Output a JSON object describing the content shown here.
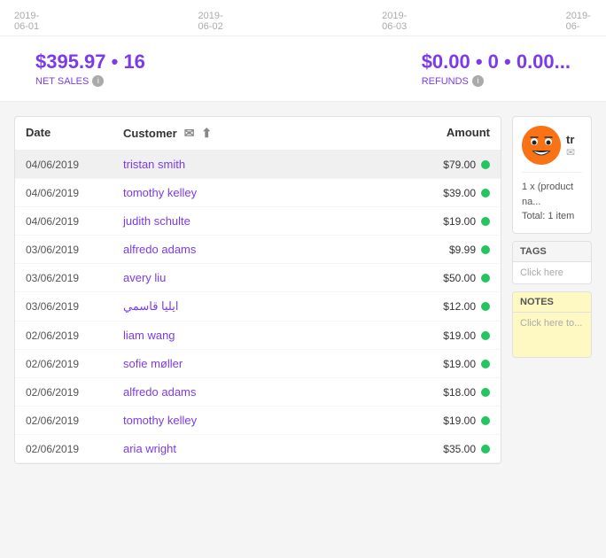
{
  "chart": {
    "dates": [
      "2019-06-01",
      "2019-06-02",
      "2019-06-03",
      "2019-06-"
    ]
  },
  "stats": {
    "net_sales_value": "$395.97 • 16",
    "net_sales_label": "NET SALES",
    "refunds_value": "$0.00 • 0 • 0.00...",
    "refunds_label": "REFUNDS"
  },
  "table": {
    "headers": {
      "date": "Date",
      "customer": "Customer",
      "amount": "Amount"
    },
    "rows": [
      {
        "date": "04/06/2019",
        "customer": "tristan smith",
        "amount": "$79.00",
        "status": "green",
        "selected": true
      },
      {
        "date": "04/06/2019",
        "customer": "tomothy kelley",
        "amount": "$39.00",
        "status": "green",
        "selected": false
      },
      {
        "date": "04/06/2019",
        "customer": "judith schulte",
        "amount": "$19.00",
        "status": "green",
        "selected": false
      },
      {
        "date": "03/06/2019",
        "customer": "alfredo adams",
        "amount": "$9.99",
        "status": "green",
        "selected": false
      },
      {
        "date": "03/06/2019",
        "customer": "avery liu",
        "amount": "$50.00",
        "status": "green",
        "selected": false
      },
      {
        "date": "03/06/2019",
        "customer": "ايليا قاسمي",
        "amount": "$12.00",
        "status": "green",
        "selected": false
      },
      {
        "date": "02/06/2019",
        "customer": "liam wang",
        "amount": "$19.00",
        "status": "green",
        "selected": false
      },
      {
        "date": "02/06/2019",
        "customer": "sofie møller",
        "amount": "$19.00",
        "status": "green",
        "selected": false
      },
      {
        "date": "02/06/2019",
        "customer": "alfredo adams",
        "amount": "$18.00",
        "status": "green",
        "selected": false
      },
      {
        "date": "02/06/2019",
        "customer": "tomothy kelley",
        "amount": "$19.00",
        "status": "green",
        "selected": false
      },
      {
        "date": "02/06/2019",
        "customer": "aria wright",
        "amount": "$35.00",
        "status": "green",
        "selected": false
      }
    ]
  },
  "customer_panel": {
    "avatar_emoji": "🤡",
    "name_initial": "tr",
    "email_placeholder": "✉",
    "product_line": "1 x (product na...",
    "total": "Total: 1 item"
  },
  "tags_panel": {
    "header": "TAGS",
    "body": "Click here"
  },
  "notes_panel": {
    "header": "NOTES",
    "body": "Click here to..."
  }
}
